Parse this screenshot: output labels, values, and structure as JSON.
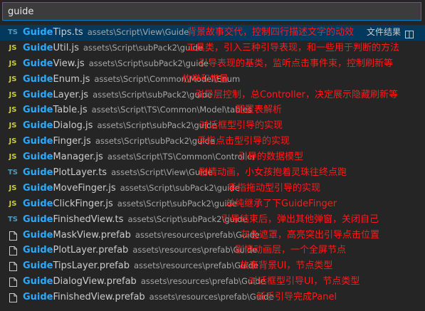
{
  "search": {
    "value": "guide",
    "placeholder": ""
  },
  "actions": {
    "exclude_label": "文件结果"
  },
  "highlight_color": "#2aaaff",
  "annotation_color": "#ff1a1a",
  "results": [
    {
      "icon": "ts",
      "match": "Guide",
      "rest": "Tips.ts",
      "path": "assets\\Script\\View\\Guide",
      "note": "背景故事交代，控制四行描述文字的动效"
    },
    {
      "icon": "js",
      "match": "Guide",
      "rest": "Util.js",
      "path": "assets\\Script\\subPack2\\guide",
      "note": "工具类，引入三种引导表现，和一些用于判断的方法"
    },
    {
      "icon": "js",
      "match": "Guide",
      "rest": "View.js",
      "path": "assets\\Script\\subPack2\\guide",
      "note": "引导表现的基类，监听点击事件束，控制刷新等"
    },
    {
      "icon": "js",
      "match": "Guide",
      "rest": "Enum.js",
      "path": "assets\\Script\\Common\\Model\\Enum",
      "note": "枚举和常量"
    },
    {
      "icon": "js",
      "match": "Guide",
      "rest": "Layer.js",
      "path": "assets\\Script\\subPack2\\guide",
      "note": "引导层控制，总Controller，决定展示隐藏刷新等"
    },
    {
      "icon": "js",
      "match": "Guide",
      "rest": "Table.js",
      "path": "assets\\Script\\TS\\Common\\Model\\tables",
      "note": "配置表解析"
    },
    {
      "icon": "js",
      "match": "Guide",
      "rest": "Dialog.js",
      "path": "assets\\Script\\subPack2\\guide",
      "note": "对话框型引导的实现"
    },
    {
      "icon": "js",
      "match": "Guide",
      "rest": "Finger.js",
      "path": "assets\\Script\\subPack2\\guide",
      "note": "手指点击型引导的实现"
    },
    {
      "icon": "js",
      "match": "Guide",
      "rest": "Manager.js",
      "path": "assets\\Script\\TS\\Common\\Controller",
      "note": "引导的数据模型"
    },
    {
      "icon": "ts",
      "match": "Guide",
      "rest": "PlotLayer.ts",
      "path": "assets\\Script\\View\\Guide",
      "note": "剧情动画，小女孩抱着灵珠往终点跑"
    },
    {
      "icon": "js",
      "match": "Guide",
      "rest": "MoveFinger.js",
      "path": "assets\\Script\\subPack2\\guide",
      "note": "手指拖动型引导的实现"
    },
    {
      "icon": "js",
      "match": "Guide",
      "rest": "ClickFinger.js",
      "path": "assets\\Script\\subPack2\\guide",
      "note": "单纯继承了下GuideFinger"
    },
    {
      "icon": "ts",
      "match": "Guide",
      "rest": "FinishedView.ts",
      "path": "assets\\Script\\subPack2\\guide",
      "note": "引导结束后，弹出其他弹窗，关闭自己"
    },
    {
      "icon": "prefab",
      "match": "Guide",
      "rest": "MaskView.prefab",
      "path": "assets\\resources\\prefab\\Guide",
      "note": "灰色遮罩，高亮突出引导点击位置"
    },
    {
      "icon": "prefab",
      "match": "Guide",
      "rest": "PlotLayer.prefab",
      "path": "assets\\resources\\prefab\\Guide",
      "note": "剧情动画层，一个全屏节点"
    },
    {
      "icon": "prefab",
      "match": "Guide",
      "rest": "TipsLayer.prefab",
      "path": "assets\\resources\\prefab\\Guide",
      "note": "故事背景UI，节点类型"
    },
    {
      "icon": "prefab",
      "match": "Guide",
      "rest": "DialogView.prefab",
      "path": "assets\\resources\\prefab\\Guide",
      "note": "对话框型引导UI，节点类型"
    },
    {
      "icon": "prefab",
      "match": "Guide",
      "rest": "FinishedView.prefab",
      "path": "assets\\resources\\prefab\\Guide",
      "note": "新手引导完成Panel"
    }
  ]
}
